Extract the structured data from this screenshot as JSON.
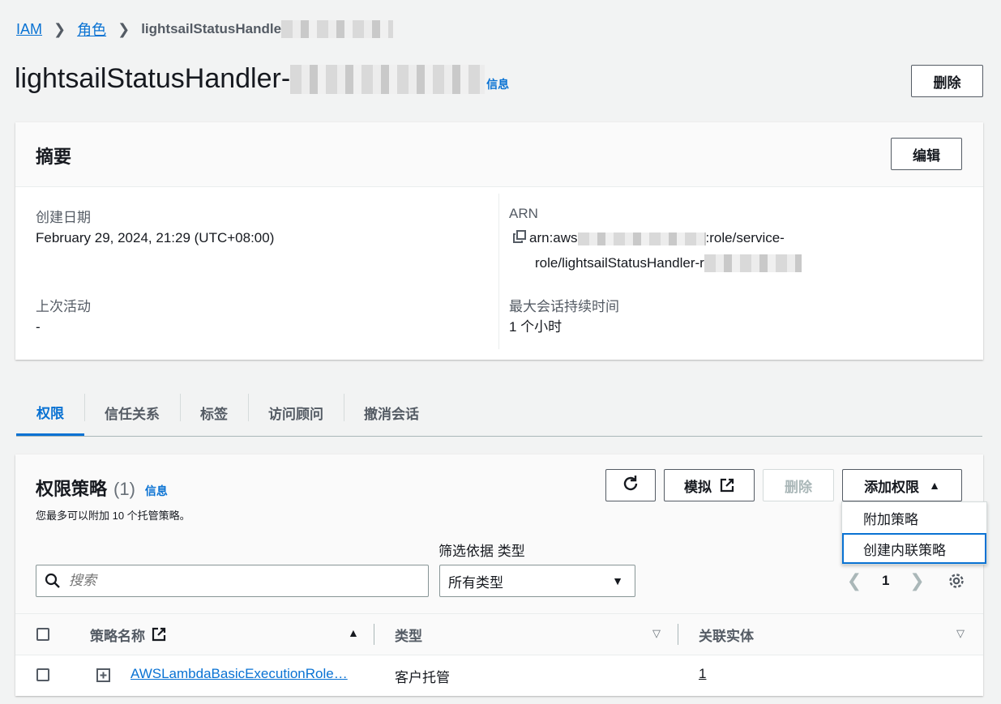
{
  "breadcrumb": {
    "items": [
      "IAM",
      "角色"
    ],
    "current": "lightsailStatusHandle"
  },
  "page": {
    "title": "lightsailStatusHandler-",
    "info": "信息",
    "delete_label": "删除"
  },
  "summary": {
    "title": "摘要",
    "edit_label": "编辑",
    "created_label": "创建日期",
    "created_value": "February 29, 2024, 21:29 (UTC+08:00)",
    "arn_label": "ARN",
    "arn_line1_prefix": "arn:aws",
    "arn_line1_suffix": ":role/service-",
    "arn_line2": "role/lightsailStatusHandler-r",
    "last_activity_label": "上次活动",
    "last_activity_value": "-",
    "max_session_label": "最大会话持续时间",
    "max_session_value": "1 个小时"
  },
  "tabs": [
    "权限",
    "信任关系",
    "标签",
    "访问顾问",
    "撤消会话"
  ],
  "permissions": {
    "title": "权限策略",
    "count": "(1)",
    "info": "信息",
    "description": "您最多可以附加 10 个托管策略。",
    "simulate_label": "模拟",
    "delete_label": "删除",
    "add_label": "添加权限",
    "search_placeholder": "搜索",
    "filter_label": "筛选依据 类型",
    "filter_value": "所有类型",
    "page_number": "1",
    "columns": [
      "策略名称",
      "类型",
      "关联实体"
    ],
    "rows": [
      {
        "name": "AWSLambdaBasicExecutionRole…",
        "type": "客户托管",
        "entities": "1"
      }
    ]
  },
  "add_menu": {
    "items": [
      "附加策略",
      "创建内联策略"
    ]
  },
  "colors": {
    "accent": "#0972d3",
    "background": "#f2f3f3",
    "text": "#16191f",
    "muted": "#545b64"
  }
}
